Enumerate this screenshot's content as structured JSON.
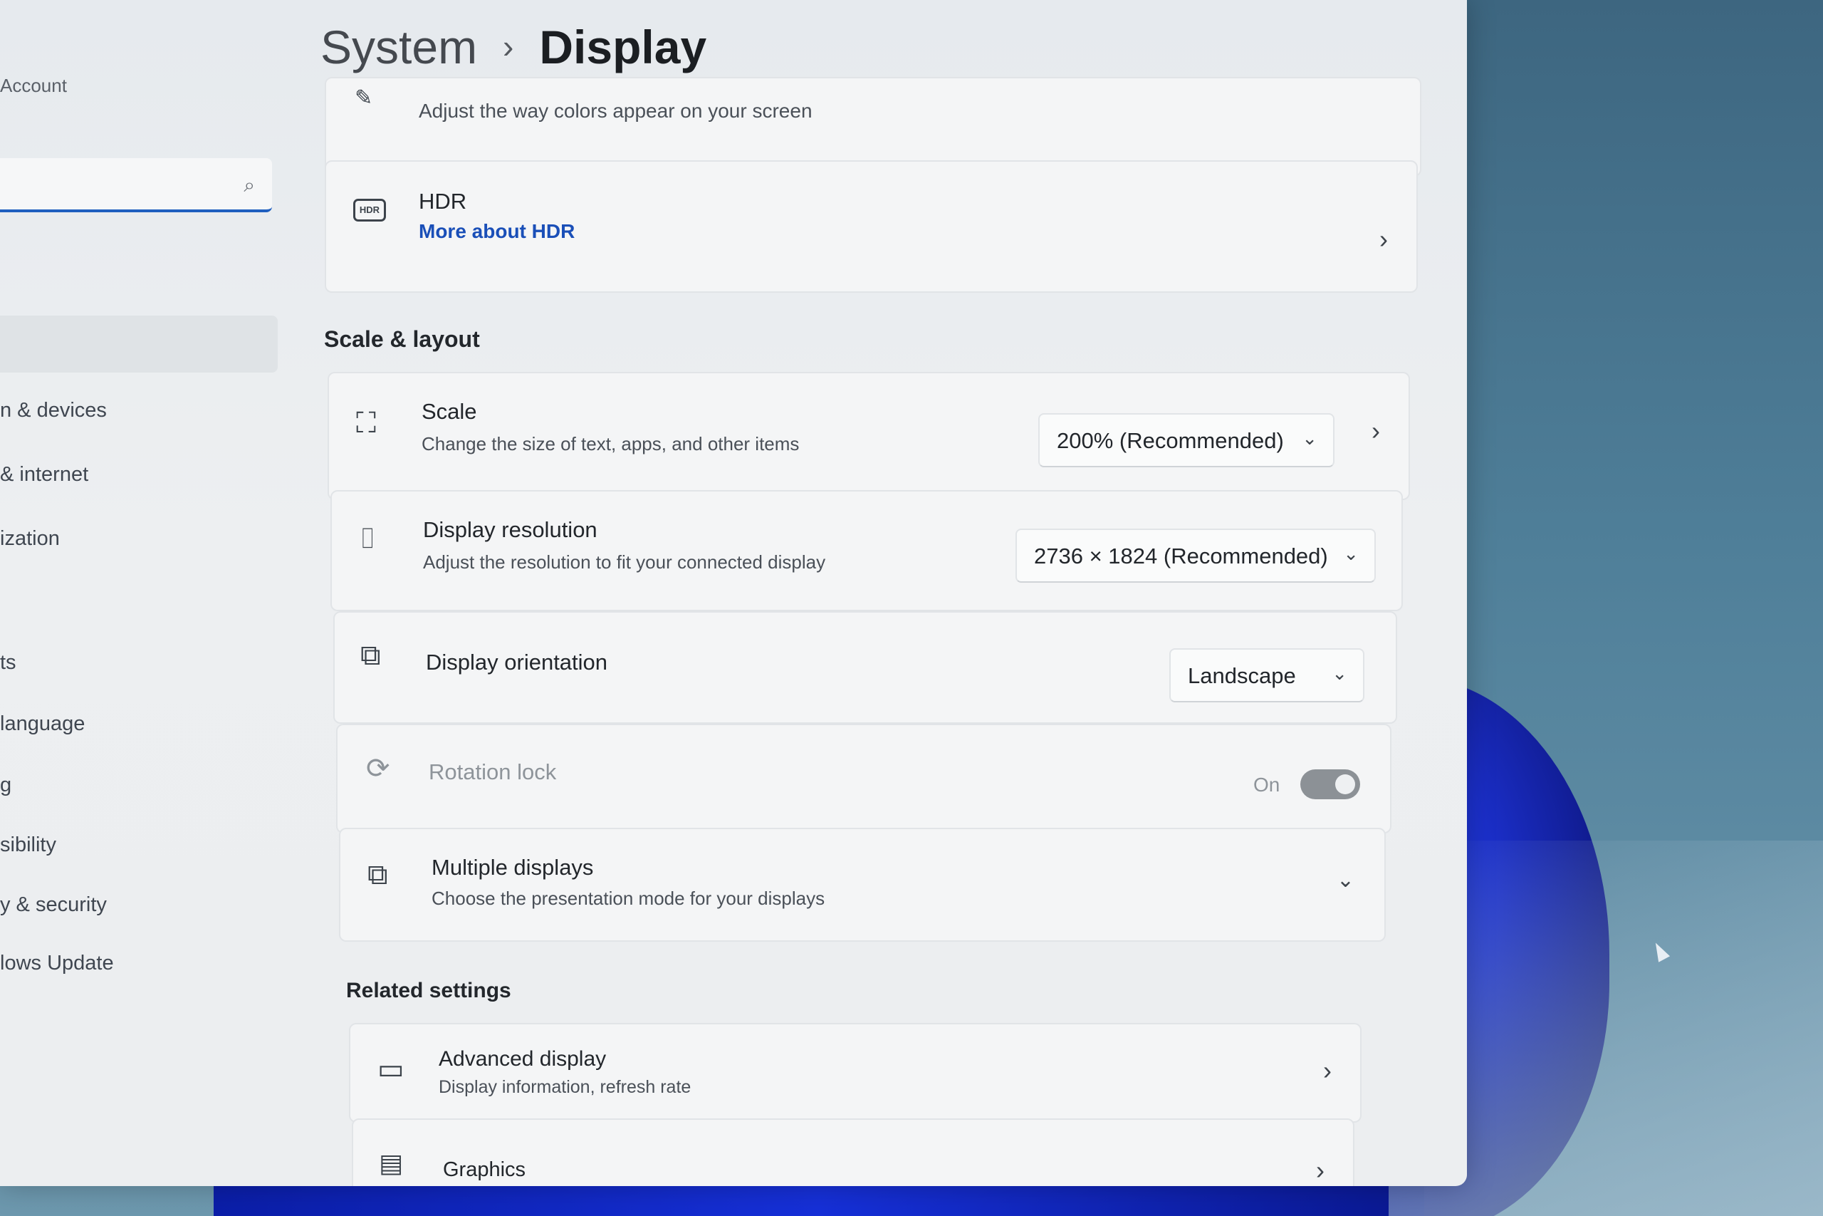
{
  "breadcrumb": {
    "parent": "System",
    "separator": "›",
    "current": "Display"
  },
  "sidebar": {
    "account_label": "Account",
    "search_placeholder": "",
    "items": [
      {
        "label": "n & devices"
      },
      {
        "label": "& internet"
      },
      {
        "label": "ization"
      },
      {
        "label": "ts"
      },
      {
        "label": " language"
      },
      {
        "label": "g"
      },
      {
        "label": "sibility"
      },
      {
        "label": "y & security"
      },
      {
        "label": "lows Update"
      }
    ]
  },
  "color_profile": {
    "subtitle": "Adjust the way colors appear on your screen"
  },
  "hdr": {
    "icon_text": "HDR",
    "title": "HDR",
    "link": "More about HDR"
  },
  "scale_layout": {
    "heading": "Scale & layout",
    "scale": {
      "title": "Scale",
      "subtitle": "Change the size of text, apps, and other items",
      "value": "200% (Recommended)"
    },
    "resolution": {
      "title": "Display resolution",
      "subtitle": "Adjust the resolution to fit your connected display",
      "value": "2736 × 1824 (Recommended)"
    },
    "orientation": {
      "title": "Display orientation",
      "value": "Landscape"
    },
    "rotation_lock": {
      "title": "Rotation lock",
      "state_label": "On",
      "on": true
    },
    "multiple_displays": {
      "title": "Multiple displays",
      "subtitle": "Choose the presentation mode for your displays"
    }
  },
  "related": {
    "heading": "Related settings",
    "advanced": {
      "title": "Advanced display",
      "subtitle": "Display information, refresh rate"
    },
    "graphics": {
      "title": "Graphics"
    }
  },
  "colors": {
    "accent": "#1f5fbf",
    "link": "#1a4fb8",
    "wallpaper_bloom": "#1b2fc9"
  }
}
